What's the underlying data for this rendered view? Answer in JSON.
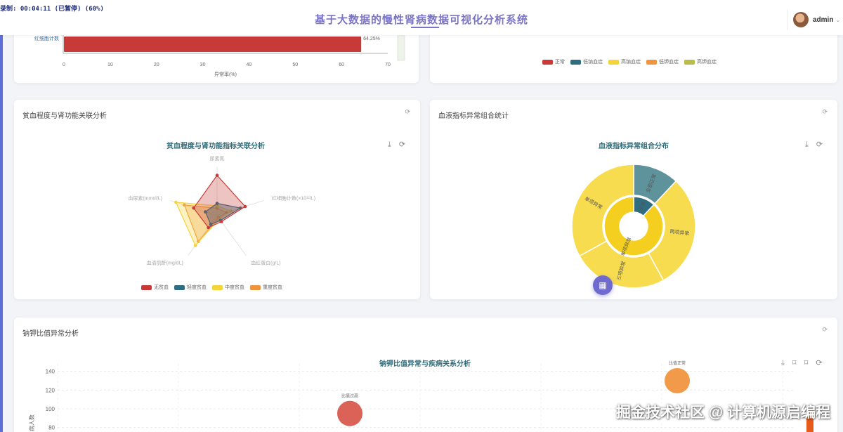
{
  "header": {
    "recording": "录制: 00:04:11 (已暂停) (60%)",
    "title": "基于大数据的慢性肾病数据可视化分析系统",
    "user_name": "admin",
    "caret": "⌄"
  },
  "top_left": {
    "bar_label": "红细胞计数",
    "bar_value_label": "64.25%",
    "ticks": [
      "0",
      "10",
      "20",
      "30",
      "40",
      "50",
      "60",
      "70"
    ],
    "xlabel": "异常率(%)"
  },
  "top_right": {
    "legend": [
      {
        "name": "正常",
        "color": "#c83a38"
      },
      {
        "name": "低钠血症",
        "color": "#2f6d80"
      },
      {
        "name": "高钠血症",
        "color": "#f5d33a"
      },
      {
        "name": "低钾血症",
        "color": "#ef9540"
      },
      {
        "name": "高钾血症",
        "color": "#b9bb4a"
      }
    ]
  },
  "anemia_card": {
    "title": "贫血程度与肾功能关联分析",
    "refresh": "⟳",
    "chart_title": "贫血程度与肾功能指标关联分析",
    "tools": "⤓ ⟳"
  },
  "blood_card": {
    "title": "血液指标异常组合统计",
    "refresh": "⟳",
    "chart_title": "血液指标异常组合分布",
    "tools": "⤓ ⟳",
    "fab_icon": "▦"
  },
  "ratio_card": {
    "title": "钠钾比值异常分析",
    "refresh": "⟳",
    "chart_title": "钠钾比值异常与疾病关系分析",
    "tools": "⤓ ⌑ ⌑ ⟳"
  },
  "watermark": "掘金技术社区 @ 计算机源启编程",
  "chart_data": [
    {
      "type": "bar",
      "orientation": "horizontal",
      "categories": [
        "红细胞计数"
      ],
      "values": [
        64.25
      ],
      "xlabel": "异常率(%)",
      "xlim": [
        0,
        70
      ],
      "color": "#c83a38"
    },
    {
      "type": "radar",
      "title": "贫血程度与肾功能指标关联分析",
      "indicators": [
        "尿素氮",
        "红细胞计数(×10¹²/L)",
        "血红蛋白(g/L)",
        "血清肌酐(mg/dL)",
        "血尿素(mmol/L)"
      ],
      "series": [
        {
          "name": "无贫血",
          "color": "#c83a38",
          "values": [
            0.82,
            0.6,
            0.15,
            0.3,
            0.5
          ]
        },
        {
          "name": "轻度贫血",
          "color": "#2f6d80",
          "values": [
            0.25,
            0.5,
            0.12,
            0.22,
            0.25
          ]
        },
        {
          "name": "中度贫血",
          "color": "#f5d33a",
          "values": [
            0.2,
            0.3,
            0.08,
            0.75,
            0.88
          ]
        },
        {
          "name": "重度贫血",
          "color": "#ef9540",
          "values": [
            0.15,
            0.2,
            0.05,
            0.65,
            0.7
          ]
        }
      ],
      "legend_position": "bottom"
    },
    {
      "type": "sunburst",
      "title": "血液指标异常组合分布",
      "inner": [
        {
          "name": "正常",
          "value": 12,
          "color": "#2f6d80"
        },
        {
          "name": "单项异常",
          "value": 88,
          "color": "#f5cf1f"
        }
      ],
      "outer": [
        {
          "name": "全部正常",
          "value": 12,
          "color": "#5e939c"
        },
        {
          "name": "两项异常",
          "value": 30,
          "color": "#f8dc4f"
        },
        {
          "name": "三项异常",
          "value": 25,
          "color": "#f8dc4f"
        },
        {
          "name": "单项异常",
          "value": 33,
          "color": "#f8dc4f"
        }
      ]
    },
    {
      "type": "scatter",
      "title": "钠钾比值异常与疾病关系分析",
      "ylabel": "病人数",
      "yticks": [
        80,
        100,
        120,
        140
      ],
      "ylim": [
        70,
        145
      ],
      "points": [
        {
          "label": "比值过高",
          "y": 95,
          "color": "#d95a4e"
        },
        {
          "label": "比值正常",
          "y": 130,
          "color": "#ef9540"
        }
      ]
    }
  ]
}
